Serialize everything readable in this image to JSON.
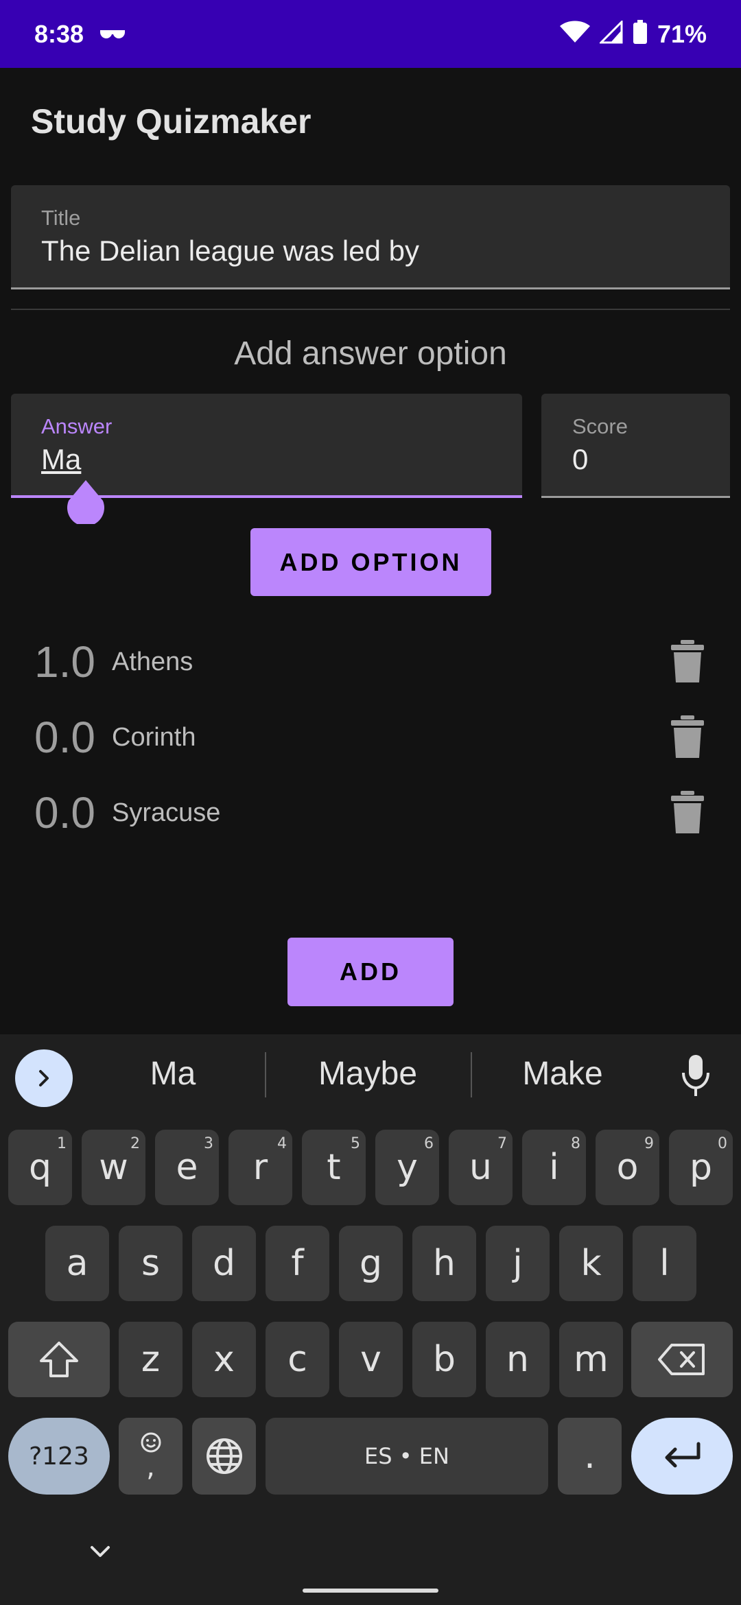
{
  "status_bar": {
    "time": "8:38",
    "battery": "71%"
  },
  "app": {
    "title": "Study Quizmaker"
  },
  "title_field": {
    "label": "Title",
    "value": "The Delian league was led by"
  },
  "answer_section": {
    "heading": "Add answer option",
    "answer_label": "Answer",
    "answer_value": "Ma",
    "score_label": "Score",
    "score_value": "0",
    "add_option_label": "ADD OPTION"
  },
  "options": [
    {
      "score": "1.0",
      "label": "Athens"
    },
    {
      "score": "0.0",
      "label": "Corinth"
    },
    {
      "score": "0.0",
      "label": "Syracuse"
    }
  ],
  "add_button_label": "ADD",
  "keyboard": {
    "suggestions": [
      "Ma",
      "Maybe",
      "Make"
    ],
    "row1": [
      {
        "k": "q",
        "h": "1"
      },
      {
        "k": "w",
        "h": "2"
      },
      {
        "k": "e",
        "h": "3"
      },
      {
        "k": "r",
        "h": "4"
      },
      {
        "k": "t",
        "h": "5"
      },
      {
        "k": "y",
        "h": "6"
      },
      {
        "k": "u",
        "h": "7"
      },
      {
        "k": "i",
        "h": "8"
      },
      {
        "k": "o",
        "h": "9"
      },
      {
        "k": "p",
        "h": "0"
      }
    ],
    "row2": [
      "a",
      "s",
      "d",
      "f",
      "g",
      "h",
      "j",
      "k",
      "l"
    ],
    "row3": [
      "z",
      "x",
      "c",
      "v",
      "b",
      "n",
      "m"
    ],
    "symbols_label": "?123",
    "emoji_comma": ",",
    "space_label": "ES • EN",
    "period": "."
  }
}
